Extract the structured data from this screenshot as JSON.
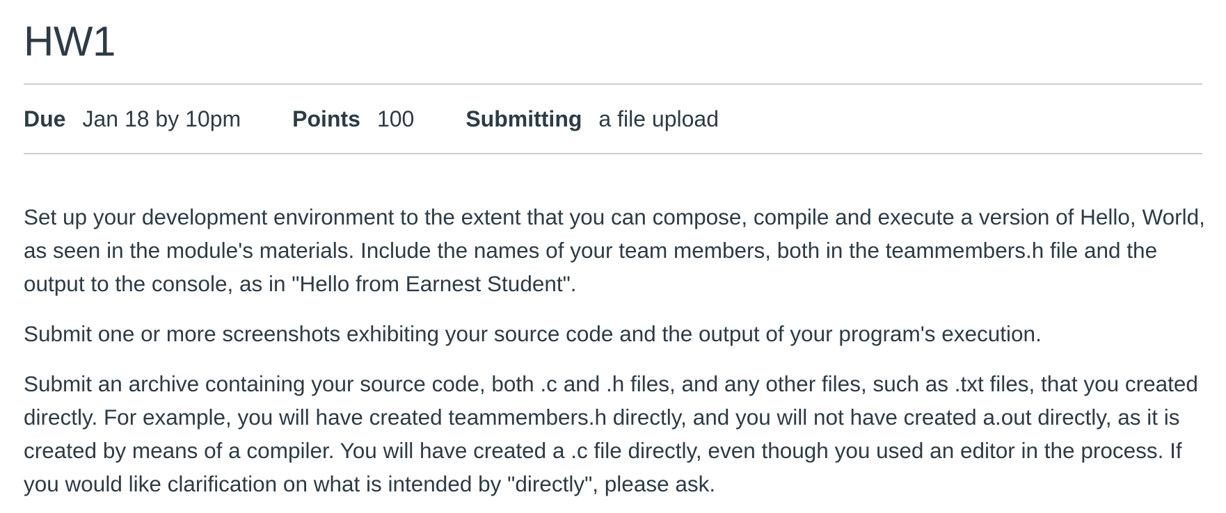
{
  "assignment": {
    "title": "HW1",
    "details": {
      "due_label": "Due",
      "due_value": "Jan 18 by 10pm",
      "points_label": "Points",
      "points_value": "100",
      "submitting_label": "Submitting",
      "submitting_value": "a file upload"
    },
    "description": [
      "Set up your development environment to the extent that you can compose, compile and execute a version of Hello, World, as seen in the module's materials. Include the names of your team members, both in the teammembers.h file and the output to the console, as in \"Hello from Earnest Student\".",
      "Submit one or more screenshots exhibiting your source code and the output of your program's execution.",
      "Submit an archive containing your source code, both .c and .h files, and any other files, such as .txt files, that you created directly. For example, you will have created teammembers.h directly, and you will not have created a.out directly, as it is created by means of a compiler. You will have created a .c file directly, even though you used an editor in the process. If you would like clarification on what is intended by \"directly\", please ask."
    ]
  },
  "colors": {
    "text": "#2d3b45",
    "divider": "#c7cdd1",
    "background": "#ffffff"
  }
}
